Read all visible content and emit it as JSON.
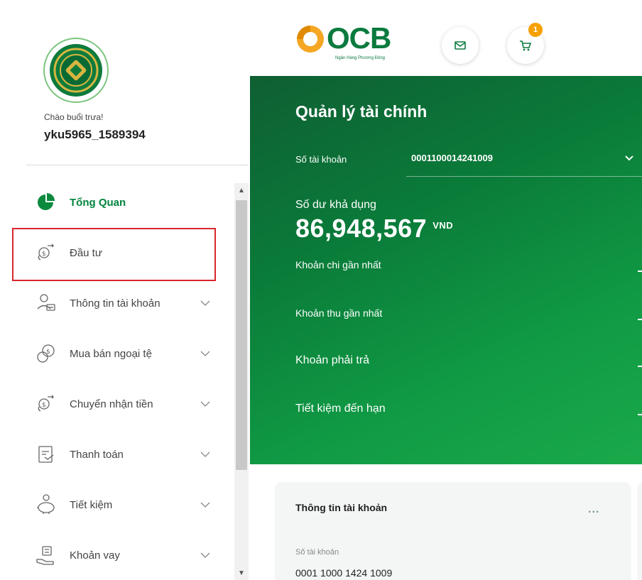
{
  "user": {
    "greeting": "Chào buổi trưa!",
    "username": "yku5965_1589394"
  },
  "sidebar": {
    "items": [
      {
        "label": "Tổng Quan",
        "icon": "pie-chart-icon",
        "active": true,
        "has_chevron": false
      },
      {
        "label": "Đầu tư",
        "icon": "coin-exchange-icon",
        "active": false,
        "has_chevron": false
      },
      {
        "label": "Thông tin tài khoản",
        "icon": "user-card-icon",
        "active": false,
        "has_chevron": true
      },
      {
        "label": "Mua bán ngoại tệ",
        "icon": "currency-coins-icon",
        "active": false,
        "has_chevron": true
      },
      {
        "label": "Chuyển nhận tiền",
        "icon": "money-transfer-icon",
        "active": false,
        "has_chevron": true
      },
      {
        "label": "Thanh toán",
        "icon": "bill-payment-icon",
        "active": false,
        "has_chevron": true
      },
      {
        "label": "Tiết kiệm",
        "icon": "piggy-bank-icon",
        "active": false,
        "has_chevron": true
      },
      {
        "label": "Khoản vay",
        "icon": "loan-hand-icon",
        "active": false,
        "has_chevron": true
      }
    ]
  },
  "header": {
    "brand": "OCB",
    "brand_subtitle": "Ngân Hàng Phương Đông",
    "cart_count": "1"
  },
  "finance": {
    "title": "Quản lý tài chính",
    "account_label": "Số tài khoản",
    "account_number": "0001100014241009",
    "balance_label": "Số dư khả dụng",
    "balance_amount": "86,948,567",
    "balance_currency": "VND",
    "rows": [
      {
        "label": "Khoản chi gần nhất"
      },
      {
        "label": "Khoản thu gần nhất"
      },
      {
        "label": "Khoản phải trả"
      },
      {
        "label": "Tiết kiệm đến hạn"
      }
    ]
  },
  "account_card": {
    "title": "Thông tin tài khoản",
    "more_label": "...",
    "field_label": "Số tài khoản",
    "field_value": "0001 1000 1424 1009"
  },
  "colors": {
    "brand_green": "#00843d",
    "highlight_red": "#d9262c",
    "badge_orange": "#f6a000"
  }
}
